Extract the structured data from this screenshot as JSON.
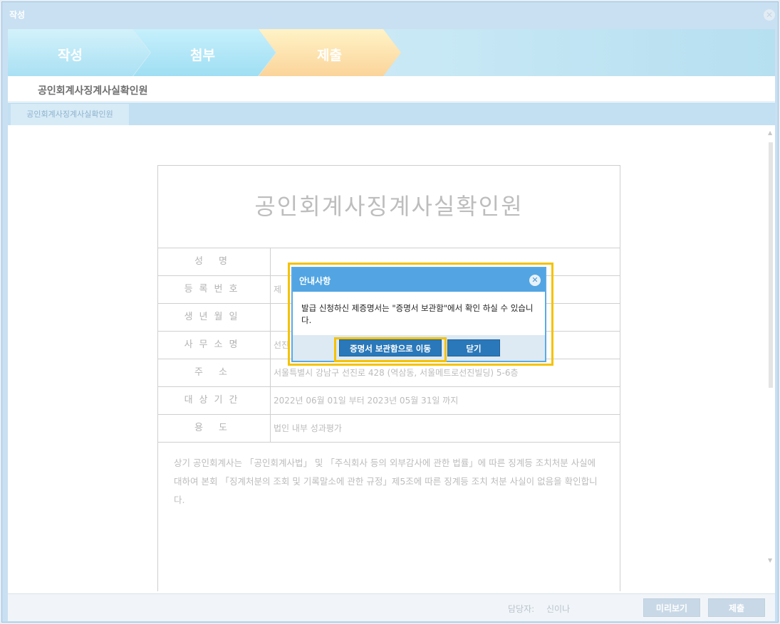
{
  "window": {
    "title": "작성",
    "close_glyph": "✕"
  },
  "steps": [
    {
      "label": "작성"
    },
    {
      "label": "첨부"
    },
    {
      "label": "제출"
    }
  ],
  "doc_header": {
    "title": "공인회계사징계사실확인원"
  },
  "tab": {
    "label": "공인회계사징계사실확인원"
  },
  "document": {
    "title": "공인회계사징계사실확인원",
    "rows": [
      {
        "label": "성 명",
        "value": ""
      },
      {
        "label": "등록번호",
        "value": "제"
      },
      {
        "label": "생년월일",
        "value": ""
      },
      {
        "label": "사무소명",
        "value": "선진"
      },
      {
        "label": "주 소",
        "value": "서울특별시 강남구 선진로 428 (역삼동, 서울메트로선진빌딩) 5-6층"
      },
      {
        "label": "대상기간",
        "value": "2022년 06월 01일 부터 2023년 05월 31일 까지"
      },
      {
        "label": "용 도",
        "value": "법인 내부 성과평가"
      }
    ],
    "body": "상기 공인회계사는 「공인회계사법」 및 「주식회사 등의 외부감사에 관한 법률」에 따른 징계등 조치처분 사실에 대하여 본회 「징계처분의 조회 및 기록말소에 관한 규정」제5조에 따른 징계등 조치 처분 사실이 없음을 확인합니다."
  },
  "footer": {
    "manager_label": "담당자:",
    "manager_name": "신이나",
    "preview_button": "미리보기",
    "submit_button": "제출"
  },
  "modal": {
    "title": "안내사항",
    "close_glyph": "✕",
    "message": "발급 신청하신 제증명서는 \"증명서 보관함\"에서 확인 하실 수 있습니다.",
    "move_button": "증명서 보관함으로 이동",
    "close_button": "닫기"
  },
  "colors": {
    "modal_header": "#52a5e2",
    "highlight": "#f5c200",
    "primary_button": "#2a78b9"
  }
}
